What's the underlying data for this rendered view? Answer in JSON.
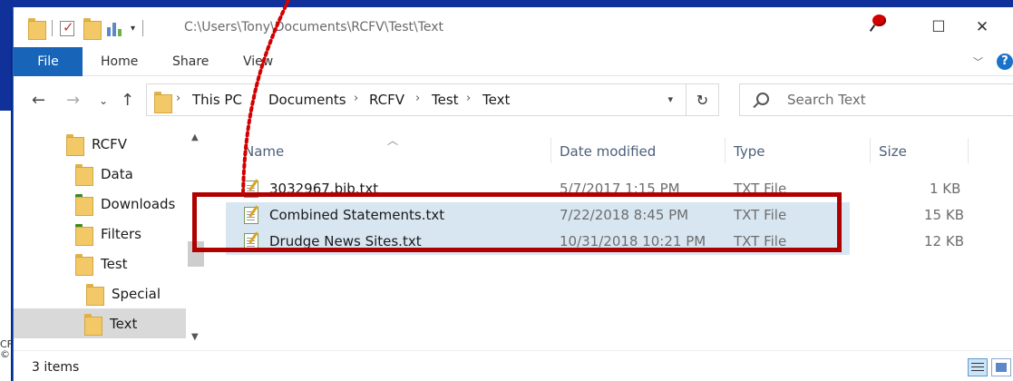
{
  "window": {
    "title_path": "C:\\Users\\Tony\\Documents\\RCFV\\Test\\Text",
    "minimize_glyph": "—",
    "maximize_glyph": "☐",
    "close_glyph": "✕"
  },
  "ribbon": {
    "tabs": [
      "File",
      "Home",
      "Share",
      "View"
    ],
    "expand_glyph": "﹀",
    "help_glyph": "?"
  },
  "nav": {
    "back_glyph": "←",
    "forward_glyph": "→",
    "recent_glyph": "⌄",
    "up_glyph": "↑",
    "breadcrumb": [
      "This PC",
      "Documents",
      "RCFV",
      "Test",
      "Text"
    ],
    "breadcrumb_sep": "›",
    "refresh_glyph": "↻",
    "search_placeholder": "Search Text"
  },
  "tree": {
    "items": [
      {
        "label": "RCFV"
      },
      {
        "label": "Data"
      },
      {
        "label": "Downloads"
      },
      {
        "label": "Filters"
      },
      {
        "label": "Test"
      },
      {
        "label": "Special"
      },
      {
        "label": "Text"
      }
    ]
  },
  "filelist": {
    "columns": [
      "Name",
      "Date modified",
      "Type",
      "Size"
    ],
    "rows": [
      {
        "name": "3032967.bib.txt",
        "date": "5/7/2017 1:15 PM",
        "type": "TXT File",
        "size": "1 KB"
      },
      {
        "name": "Combined Statements.txt",
        "date": "7/22/2018 8:45 PM",
        "type": "TXT File",
        "size": "15 KB"
      },
      {
        "name": "Drudge News Sites.txt",
        "date": "10/31/2018 10:21 PM",
        "type": "TXT File",
        "size": "12 KB"
      }
    ]
  },
  "status": {
    "items_count": "3 items"
  },
  "background": {
    "left_text": "CF ©"
  },
  "colors": {
    "accent": "#1764b8",
    "selection": "#d8e6f2",
    "highlight_box": "#b00000",
    "annotation": "#d40000"
  }
}
